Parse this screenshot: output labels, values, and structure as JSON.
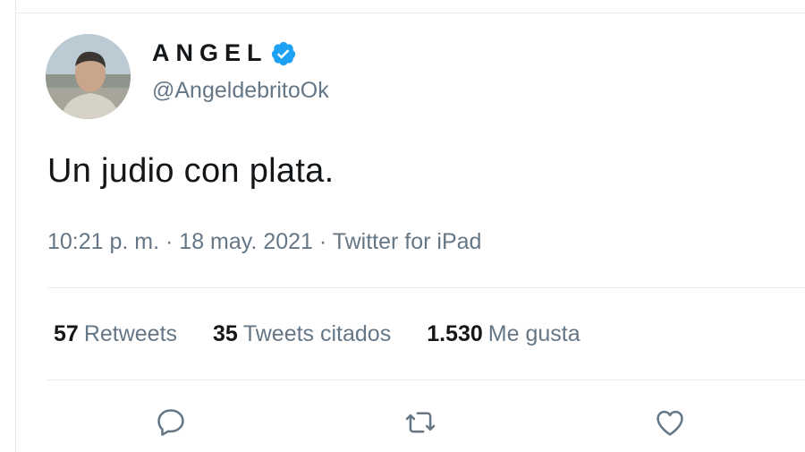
{
  "tweet": {
    "author": {
      "display_name": "ANGEL",
      "handle": "@AngeldebritoOk",
      "verified": true
    },
    "text": "Un judio con plata.",
    "meta": {
      "time": "10:21 p. m.",
      "separator": " · ",
      "date": "18 may. 2021",
      "source": "Twitter for iPad"
    },
    "stats": {
      "retweets_count": "57",
      "retweets_label": "Retweets",
      "quotes_count": "35",
      "quotes_label": "Tweets citados",
      "likes_count": "1.530",
      "likes_label": "Me gusta"
    },
    "actions": [
      "reply-icon",
      "retweet-icon",
      "like-icon"
    ]
  },
  "colors": {
    "text_primary": "#14171a",
    "text_secondary": "#657786",
    "divider": "#e6ecf0",
    "accent": "#1da1f2"
  }
}
